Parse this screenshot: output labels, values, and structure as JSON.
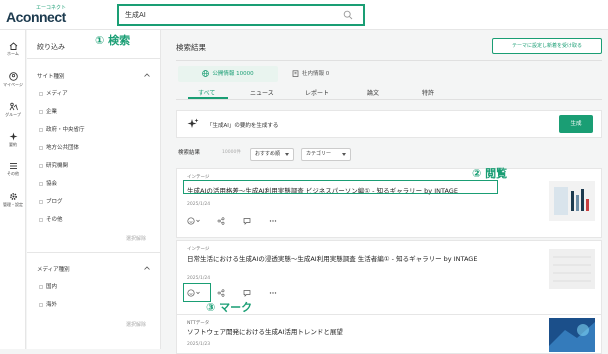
{
  "brand": {
    "small": "エーコネクト",
    "name": "Aconnect"
  },
  "search": {
    "value": "生成AI"
  },
  "nav": [
    {
      "label": "ホーム"
    },
    {
      "label": "マイページ"
    },
    {
      "label": "グループ"
    },
    {
      "label": "要約"
    },
    {
      "label": "その他"
    },
    {
      "label": "管理・設定"
    }
  ],
  "filter": {
    "title": "絞り込み",
    "site": {
      "heading": "サイト種別",
      "items": [
        "メディア",
        "企業",
        "政府・中央省庁",
        "地方公共団体",
        "研究機関",
        "協会",
        "ブログ",
        "その他"
      ],
      "clear": "選択解除"
    },
    "media": {
      "heading": "メディア種別",
      "items": [
        "国内",
        "海外"
      ],
      "clear": "選択解除"
    }
  },
  "main": {
    "title": "検索結果",
    "subscribe_button": "テーマに設定し新着を受け取る",
    "scope": {
      "public": "公開情報 10000",
      "internal": "社内情報 0"
    },
    "tabs": [
      "すべて",
      "ニュース",
      "レポート",
      "論文",
      "特許"
    ],
    "ai_summary": {
      "text": "「生成AI」の要約を生成する",
      "button": "生成"
    },
    "sort": {
      "label": "検索結果",
      "count": "10000件",
      "order": "おすすめ順",
      "category": "カテゴリー"
    }
  },
  "cards": [
    {
      "source": "インテージ",
      "title": "生成AIの活用格差〜生成AI利用実態調査 ビジネスパーソン編① - 知るギャラリー by INTAGE",
      "date": "2025/1/24"
    },
    {
      "source": "インテージ",
      "title": "日常生活における生成AIの浸透実態〜生成AI利用実態調査 生活者編① - 知るギャラリー by INTAGE",
      "date": "2025/1/24"
    },
    {
      "source": "NTTデータ",
      "title": "ソフトウェア開発における生成AI活用トレンドと展望",
      "date": "2025/1/23"
    }
  ],
  "annotations": {
    "search": "① 検索",
    "read": "② 閲覧",
    "mark": "③ マーク"
  },
  "colors": {
    "accent": "#1a9e74",
    "navy": "#1d3b4f"
  }
}
